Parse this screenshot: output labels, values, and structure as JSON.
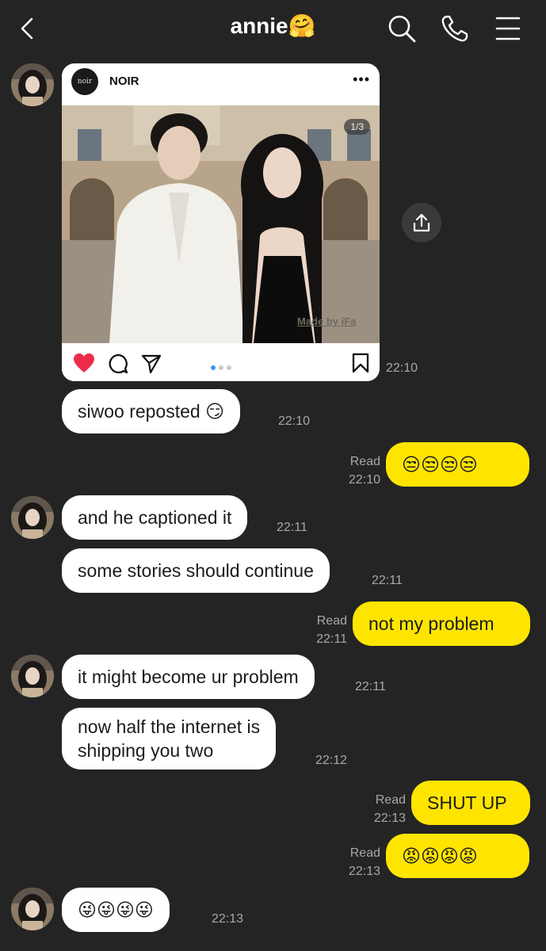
{
  "header": {
    "title": "annie🤗",
    "icons": [
      "back-arrow-icon",
      "search-icon",
      "phone-icon",
      "menu-icon"
    ]
  },
  "post_card": {
    "account": "NOIR",
    "logo_text": "noir",
    "counter": "1/3",
    "watermark": "Made by iFa",
    "time": "22:10"
  },
  "messages": [
    {
      "id": "m1",
      "from": "annie",
      "text": "siwoo reposted 😏",
      "time": "22:10"
    },
    {
      "id": "m2",
      "from": "me",
      "text": "😒😒😒😒",
      "read": "Read",
      "time": "22:10"
    },
    {
      "id": "m3",
      "from": "annie",
      "text": "and he captioned it",
      "time": "22:11"
    },
    {
      "id": "m4",
      "from": "annie",
      "text": "some stories should continue",
      "time": "22:11"
    },
    {
      "id": "m5",
      "from": "me",
      "text": "not my problem",
      "read": "Read",
      "time": "22:11"
    },
    {
      "id": "m6",
      "from": "annie",
      "text": "it might become ur problem",
      "time": "22:11"
    },
    {
      "id": "m7",
      "from": "annie",
      "text_line1": "now half the internet is",
      "text_line2": "shipping you two",
      "time": "22:12"
    },
    {
      "id": "m8",
      "from": "me",
      "text": "SHUT UP",
      "read": "Read",
      "time": "22:13"
    },
    {
      "id": "m9",
      "from": "me",
      "text": "😡😡😡😡",
      "read": "Read",
      "time": "22:13"
    },
    {
      "id": "m10",
      "from": "annie",
      "text": "😜😜😜😜",
      "time": "22:13"
    }
  ],
  "colors": {
    "background": "#242424",
    "my_bubble": "#fee500",
    "their_bubble": "#ffffff",
    "like": "#ed2c48",
    "carousel_active": "#3897f0"
  }
}
